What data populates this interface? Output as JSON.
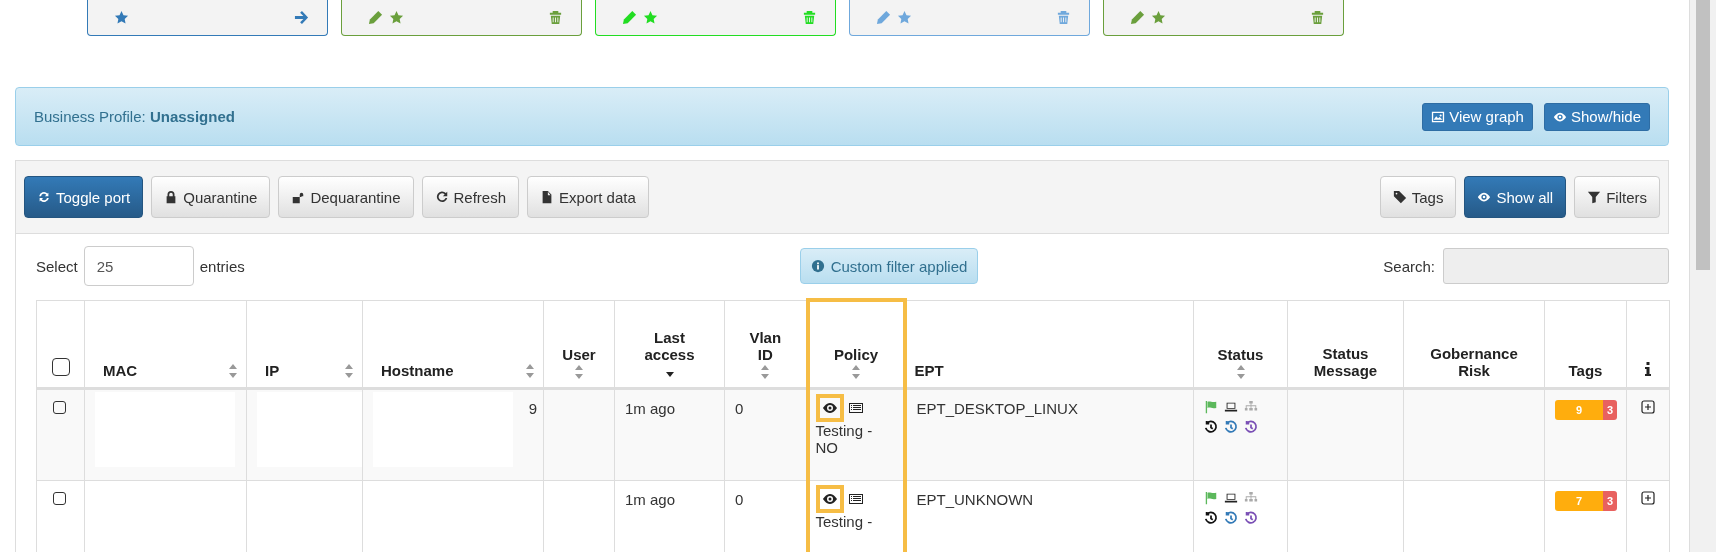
{
  "cards": [
    {
      "kind": "link",
      "color": "#337ab7"
    },
    {
      "kind": "edit",
      "color": "#6a9f3c"
    },
    {
      "kind": "edit",
      "color": "#22dd22"
    },
    {
      "kind": "edit",
      "color": "#6fa8dc"
    },
    {
      "kind": "edit",
      "color": "#6a9f3c"
    }
  ],
  "business_profile": {
    "label": "Business Profile:",
    "value": "Unassigned",
    "buttons": [
      "View graph",
      "Show/hide"
    ]
  },
  "toolbar": {
    "left": [
      {
        "label": "Toggle port",
        "primary": true
      },
      {
        "label": "Quarantine",
        "primary": false
      },
      {
        "label": "Dequarantine",
        "primary": false
      },
      {
        "label": "Refresh",
        "primary": false
      },
      {
        "label": "Export data",
        "primary": false
      }
    ],
    "right": [
      {
        "label": "Tags",
        "primary": false
      },
      {
        "label": "Show all",
        "primary": true
      },
      {
        "label": "Filters",
        "primary": false
      }
    ]
  },
  "length": {
    "before": "Select",
    "value": "25",
    "after": "entries"
  },
  "filter_notice": "Custom filter applied",
  "search": {
    "label": "Search:"
  },
  "table": {
    "columns": [
      {
        "kind": "checkbox",
        "checked": false,
        "highlighted": false
      },
      {
        "kind": "text",
        "label": "MAC",
        "sortable": true,
        "sorted": false,
        "highlighted": false
      },
      {
        "kind": "text",
        "label": "IP",
        "sortable": true,
        "sorted": false,
        "highlighted": false
      },
      {
        "kind": "text",
        "label": "Hostname",
        "sortable": true,
        "sorted": false,
        "highlighted": false
      },
      {
        "kind": "text",
        "label": "User",
        "sortable": true,
        "sorted": false,
        "highlighted": false
      },
      {
        "kind": "text",
        "label": "Last access",
        "sortable": true,
        "sorted": true,
        "highlighted": false
      },
      {
        "kind": "text",
        "label": "Vlan ID",
        "sortable": true,
        "sorted": false,
        "highlighted": false
      },
      {
        "kind": "text",
        "label": "Policy",
        "sortable": true,
        "sorted": false,
        "highlighted": true
      },
      {
        "kind": "text",
        "label": "EPT",
        "sortable": false,
        "sorted": false,
        "highlighted": false
      },
      {
        "kind": "text",
        "label": "Status",
        "sortable": true,
        "sorted": false,
        "highlighted": false
      },
      {
        "kind": "text",
        "label": "Status Message",
        "sortable": false,
        "sorted": false,
        "highlighted": false
      },
      {
        "kind": "text",
        "label": "Gobernance Risk",
        "sortable": false,
        "sorted": false,
        "highlighted": false
      },
      {
        "kind": "text",
        "label": "Tags",
        "sortable": false,
        "sorted": false,
        "highlighted": false
      },
      {
        "kind": "info",
        "highlighted": false
      }
    ],
    "rows": [
      {
        "checked": false,
        "hostname": "9",
        "last_access": "1m ago",
        "vlan": "0",
        "policy": "Testing - NO",
        "ept": "EPT_DESKTOP_LINUX",
        "tags": [
          {
            "count": "9",
            "color": "#ffad0d"
          },
          {
            "count": "3",
            "color": "#e8615f"
          }
        ]
      },
      {
        "checked": false,
        "last_access": "1m ago",
        "vlan": "0",
        "policy": "Testing -",
        "ept": "EPT_UNKNOWN",
        "tags": [
          {
            "count": "7",
            "color": "#ffad0d"
          },
          {
            "count": "3",
            "color": "#e8615f"
          }
        ]
      }
    ]
  }
}
